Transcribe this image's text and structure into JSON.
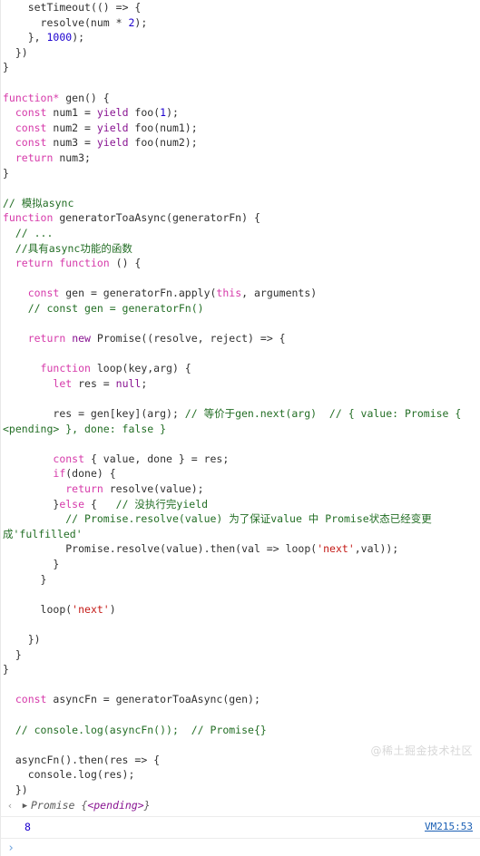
{
  "console": {
    "source_lines": [
      [
        {
          "t": "plain",
          "s": "    setTimeout(() "
        },
        {
          "t": "plain",
          "s": "=> {"
        }
      ],
      [
        {
          "t": "plain",
          "s": "      resolve(num * "
        },
        {
          "t": "num",
          "s": "2"
        },
        {
          "t": "plain",
          "s": ");"
        }
      ],
      [
        {
          "t": "plain",
          "s": "    }, "
        },
        {
          "t": "num",
          "s": "1000"
        },
        {
          "t": "plain",
          "s": ");"
        }
      ],
      [
        {
          "t": "plain",
          "s": "  })"
        }
      ],
      [
        {
          "t": "plain",
          "s": "}"
        }
      ],
      [
        {
          "t": "plain",
          "s": ""
        }
      ],
      [
        {
          "t": "kw-magenta",
          "s": "function*"
        },
        {
          "t": "plain",
          "s": " gen() {"
        }
      ],
      [
        {
          "t": "plain",
          "s": "  "
        },
        {
          "t": "kw-magenta",
          "s": "const"
        },
        {
          "t": "plain",
          "s": " num1 = "
        },
        {
          "t": "kw-purple",
          "s": "yield"
        },
        {
          "t": "plain",
          "s": " foo("
        },
        {
          "t": "num",
          "s": "1"
        },
        {
          "t": "plain",
          "s": ");"
        }
      ],
      [
        {
          "t": "plain",
          "s": "  "
        },
        {
          "t": "kw-magenta",
          "s": "const"
        },
        {
          "t": "plain",
          "s": " num2 = "
        },
        {
          "t": "kw-purple",
          "s": "yield"
        },
        {
          "t": "plain",
          "s": " foo(num1);"
        }
      ],
      [
        {
          "t": "plain",
          "s": "  "
        },
        {
          "t": "kw-magenta",
          "s": "const"
        },
        {
          "t": "plain",
          "s": " num3 = "
        },
        {
          "t": "kw-purple",
          "s": "yield"
        },
        {
          "t": "plain",
          "s": " foo(num2);"
        }
      ],
      [
        {
          "t": "plain",
          "s": "  "
        },
        {
          "t": "kw-magenta",
          "s": "return"
        },
        {
          "t": "plain",
          "s": " num3;"
        }
      ],
      [
        {
          "t": "plain",
          "s": "}"
        }
      ],
      [
        {
          "t": "plain",
          "s": ""
        }
      ],
      [
        {
          "t": "cmt",
          "s": "// 模拟async"
        }
      ],
      [
        {
          "t": "kw-magenta",
          "s": "function"
        },
        {
          "t": "plain",
          "s": " generatorToaAsync(generatorFn) {"
        }
      ],
      [
        {
          "t": "plain",
          "s": "  "
        },
        {
          "t": "cmt",
          "s": "// ..."
        }
      ],
      [
        {
          "t": "plain",
          "s": "  "
        },
        {
          "t": "cmt",
          "s": "//具有async功能的函数"
        }
      ],
      [
        {
          "t": "plain",
          "s": "  "
        },
        {
          "t": "kw-magenta",
          "s": "return"
        },
        {
          "t": "plain",
          "s": " "
        },
        {
          "t": "kw-magenta",
          "s": "function"
        },
        {
          "t": "plain",
          "s": " () {"
        }
      ],
      [
        {
          "t": "plain",
          "s": ""
        }
      ],
      [
        {
          "t": "plain",
          "s": "    "
        },
        {
          "t": "kw-magenta",
          "s": "const"
        },
        {
          "t": "plain",
          "s": " gen = generatorFn.apply("
        },
        {
          "t": "kw-magenta",
          "s": "this"
        },
        {
          "t": "plain",
          "s": ", arguments)"
        }
      ],
      [
        {
          "t": "plain",
          "s": "    "
        },
        {
          "t": "cmt",
          "s": "// const gen = generatorFn()"
        }
      ],
      [
        {
          "t": "plain",
          "s": ""
        }
      ],
      [
        {
          "t": "plain",
          "s": "    "
        },
        {
          "t": "kw-magenta",
          "s": "return"
        },
        {
          "t": "plain",
          "s": " "
        },
        {
          "t": "kw-purple",
          "s": "new"
        },
        {
          "t": "plain",
          "s": " Promise((resolve, reject) => {"
        }
      ],
      [
        {
          "t": "plain",
          "s": ""
        }
      ],
      [
        {
          "t": "plain",
          "s": "      "
        },
        {
          "t": "kw-magenta",
          "s": "function"
        },
        {
          "t": "plain",
          "s": " loop(key,arg) {"
        }
      ],
      [
        {
          "t": "plain",
          "s": "        "
        },
        {
          "t": "kw-magenta",
          "s": "let"
        },
        {
          "t": "plain",
          "s": " res = "
        },
        {
          "t": "kw-purple",
          "s": "null"
        },
        {
          "t": "plain",
          "s": ";"
        }
      ],
      [
        {
          "t": "plain",
          "s": ""
        }
      ],
      [
        {
          "t": "plain",
          "s": "        res = gen[key](arg); "
        },
        {
          "t": "cmt",
          "s": "// 等价于gen.next(arg)  // { value: Promise { <pending> }, done: false }"
        }
      ],
      [
        {
          "t": "plain",
          "s": ""
        }
      ],
      [
        {
          "t": "plain",
          "s": "        "
        },
        {
          "t": "kw-magenta",
          "s": "const"
        },
        {
          "t": "plain",
          "s": " { value, done } = res;"
        }
      ],
      [
        {
          "t": "plain",
          "s": "        "
        },
        {
          "t": "kw-magenta",
          "s": "if"
        },
        {
          "t": "plain",
          "s": "(done) {"
        }
      ],
      [
        {
          "t": "plain",
          "s": "          "
        },
        {
          "t": "kw-magenta",
          "s": "return"
        },
        {
          "t": "plain",
          "s": " resolve(value);"
        }
      ],
      [
        {
          "t": "plain",
          "s": "        }"
        },
        {
          "t": "kw-magenta",
          "s": "else"
        },
        {
          "t": "plain",
          "s": " {   "
        },
        {
          "t": "cmt",
          "s": "// 没执行完yield"
        }
      ],
      [
        {
          "t": "plain",
          "s": "          "
        },
        {
          "t": "cmt",
          "s": "// Promise.resolve(value) 为了保证value 中 Promise状态已经变更成'fulfilled'"
        }
      ],
      [
        {
          "t": "plain",
          "s": "          Promise.resolve(value).then(val => loop("
        },
        {
          "t": "str",
          "s": "'next'"
        },
        {
          "t": "plain",
          "s": ",val));"
        }
      ],
      [
        {
          "t": "plain",
          "s": "        }"
        }
      ],
      [
        {
          "t": "plain",
          "s": "      }"
        }
      ],
      [
        {
          "t": "plain",
          "s": ""
        }
      ],
      [
        {
          "t": "plain",
          "s": "      loop("
        },
        {
          "t": "str",
          "s": "'next'"
        },
        {
          "t": "plain",
          "s": ")"
        }
      ],
      [
        {
          "t": "plain",
          "s": ""
        }
      ],
      [
        {
          "t": "plain",
          "s": "    })"
        }
      ],
      [
        {
          "t": "plain",
          "s": "  }"
        }
      ],
      [
        {
          "t": "plain",
          "s": "}"
        }
      ],
      [
        {
          "t": "plain",
          "s": ""
        }
      ],
      [
        {
          "t": "plain",
          "s": "  "
        },
        {
          "t": "kw-magenta",
          "s": "const"
        },
        {
          "t": "plain",
          "s": " asyncFn = generatorToaAsync(gen);"
        }
      ],
      [
        {
          "t": "plain",
          "s": ""
        }
      ],
      [
        {
          "t": "plain",
          "s": "  "
        },
        {
          "t": "cmt",
          "s": "// console.log(asyncFn());  // Promise{}"
        }
      ],
      [
        {
          "t": "plain",
          "s": ""
        }
      ],
      [
        {
          "t": "plain",
          "s": "  asyncFn().then(res => {"
        }
      ],
      [
        {
          "t": "plain",
          "s": "    console.log(res);"
        }
      ],
      [
        {
          "t": "plain",
          "s": "  })"
        }
      ]
    ],
    "result": {
      "return_arrow": "‹",
      "disclosure_triangle": "▶",
      "text_prefix": "Promise ",
      "text_brace_open": "{",
      "pending": "<pending>",
      "text_brace_close": "}"
    },
    "log_entry": {
      "value": "8",
      "source_link": "VM215:53"
    },
    "prompt": {
      "chevron": "›",
      "value": ""
    },
    "watermark": "@稀土掘金技术社区"
  }
}
